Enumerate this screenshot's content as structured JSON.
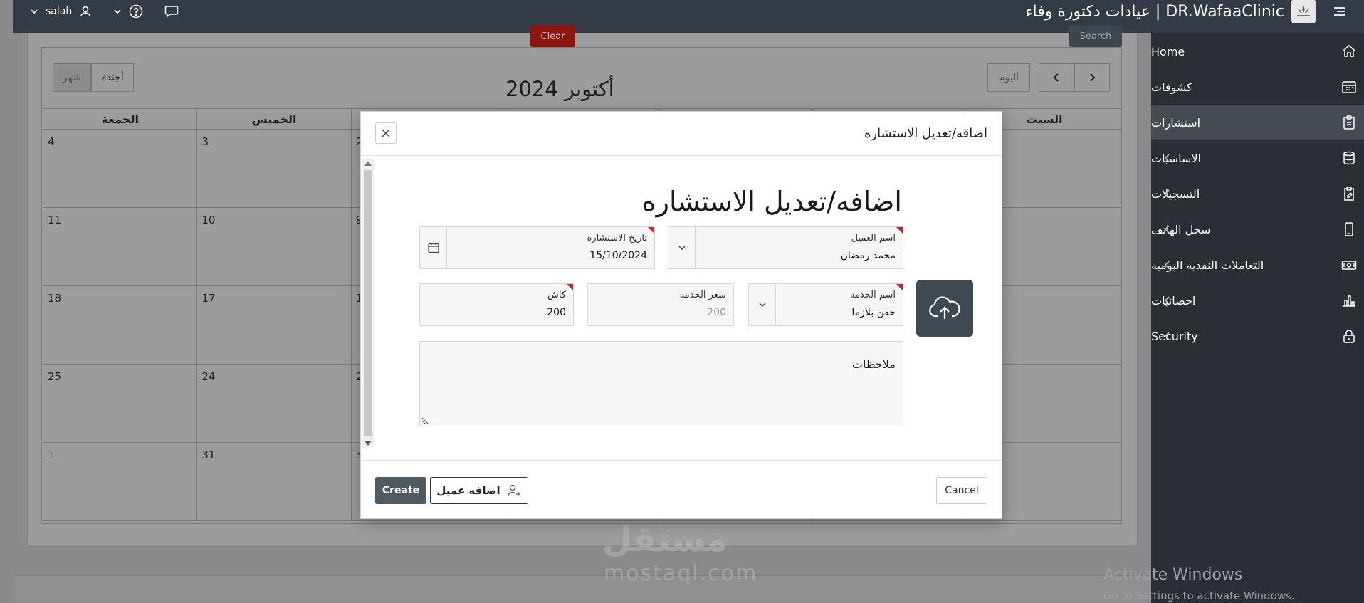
{
  "header": {
    "user_name": "salah",
    "app_title": "DR.WafaaClinic | عيادات دكتورة وفاء"
  },
  "sidebar": {
    "items": [
      {
        "label": "Home",
        "icon": "home-icon"
      },
      {
        "label": "كشوفات",
        "icon": "calendar-grid-icon"
      },
      {
        "label": "استشارات",
        "icon": "clipboard-icon",
        "active": true
      },
      {
        "label": "الاساسيات",
        "icon": "database-icon"
      },
      {
        "label": "التسجيلات",
        "icon": "clipboard-edit-icon"
      },
      {
        "label": "سجل الهاتف",
        "icon": "phone-icon"
      },
      {
        "label": "التعاملات النقديه اليوميه",
        "icon": "cash-icon"
      },
      {
        "label": "احصائيات",
        "icon": "bar-chart-icon"
      },
      {
        "label": "Security",
        "icon": "lock-icon"
      }
    ]
  },
  "toolbar": {
    "clear_label": "Clear",
    "search_label": "Search"
  },
  "calendar": {
    "title": "أكتوبر 2024",
    "today_label": "اليوم",
    "view_agenda": "أجندة",
    "view_month": "شهر",
    "weekdays": [
      "الجمعة",
      "الخميس",
      "",
      "",
      "",
      "",
      "السبت"
    ],
    "weeks": [
      [
        "4",
        "3",
        "2",
        "",
        "",
        "",
        ""
      ],
      [
        "11",
        "10",
        "9",
        "",
        "",
        "",
        ""
      ],
      [
        "18",
        "17",
        "1",
        "",
        "",
        "",
        ""
      ],
      [
        "25",
        "24",
        "2",
        "",
        "",
        "",
        ""
      ],
      [
        "1",
        "31",
        "3",
        "",
        "",
        "",
        ""
      ]
    ]
  },
  "dialog": {
    "title": "اضافه/تعديل الاستشاره",
    "heading": "اضافه/تعديل الاستشاره",
    "fields": {
      "client_name": {
        "label": "اسم العميل",
        "value": "محمد رمضان"
      },
      "consult_date": {
        "label": "تاريخ الاستشاره",
        "value": "15/10/2024"
      },
      "service_name": {
        "label": "اسم الخدمه",
        "value": "حقن بلازما"
      },
      "service_price": {
        "label": "سعر الخدمه",
        "placeholder": "200"
      },
      "cash": {
        "label": "كاش",
        "value": "200"
      },
      "notes": {
        "label": "ملاحظات"
      }
    },
    "buttons": {
      "create": "Create",
      "add_client": "اضافه عميل",
      "cancel": "Cancel"
    }
  },
  "overlay_text": {
    "watermark": "مستقل",
    "watermark_latin": "mostaql.com",
    "activate_title": "Activate Windows",
    "activate_sub": "Go to Settings to activate Windows."
  },
  "colors": {
    "header_bg": "#333c46",
    "sidebar_bg": "#2a2f35",
    "sidebar_active": "#454b52",
    "primary_button": "#505a63",
    "required_marker": "#c62828",
    "clear_button": "#8e1410"
  }
}
